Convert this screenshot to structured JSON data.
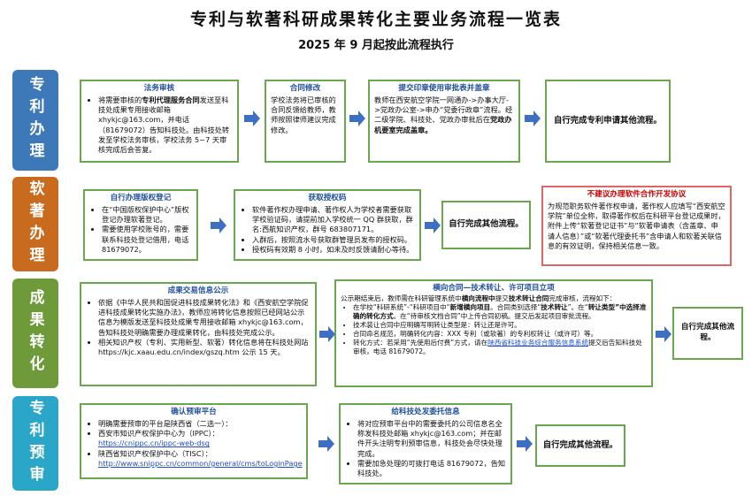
{
  "title": "专利与软著科研成果转化主要业务流程一览表",
  "subtitle": "2025 年 9 月起按此流程执行",
  "colors": {
    "lane_blue": "#3d78b8",
    "lane_orange": "#c96b1e",
    "lane_green": "#6e9a3a",
    "lane_cyan": "#2aa6c9",
    "box_border": "#6aa84f",
    "box_red": "#e06666",
    "arrow": "#3d6fc2",
    "heading": "#1f4e9e"
  },
  "lanes": [
    {
      "label": "专利办理"
    },
    {
      "label": "软著办理"
    },
    {
      "label": "成果转化"
    },
    {
      "label": "专利预审"
    }
  ],
  "patent": {
    "box1": {
      "title": "法务审核",
      "text_a": "将需要审核的",
      "text_b": "专利代理服务合同",
      "text_c": "发送至科技处成果专用接收邮箱 xhykjc@163.com，并电话（81679072）告知科技处。由科技处转发至学校法务审核，学校法务 5~7 天审核完成后会答复。"
    },
    "box2": {
      "title": "合同修改",
      "text": "学校法务将已审核的合同反馈给教师，教师按照律师建议完成修改。"
    },
    "box3": {
      "title": "提交印章使用审批表并盖章",
      "text_a": "教师在西安航空学院一网通办->办事大厅->党政办公室->申办“党委行政章”流程。经二级学院、科技处、党政办审批后在",
      "text_b": "党政办机要室完成盖章。"
    },
    "box4": {
      "text": "自行完成专利申请其他流程。"
    }
  },
  "copyright": {
    "box1": {
      "title": "自行办理版权登记",
      "items": [
        "在“中国版权保护中心”版权登记办理软著登记。",
        "需要使用学校账号的，需要联系科技处登记借用，电话 81679072。"
      ]
    },
    "box2": {
      "title": "获取授权码",
      "items": [
        "软件著作权办理申请、著作权人为学校者需要获取学校验证码，请提前加入学校统一 QQ 群获取，群名:西航知识产权，群号 683807171。",
        "入群后，按照流水号获取群管理员发布的授权码。",
        "授权码有效期 8 小时，如未及时反馈请耐心等待。"
      ]
    },
    "box3": {
      "text": "自行完成其他流程。"
    },
    "box4": {
      "title": "不建议办理软件合作开发协议",
      "text": "为规范职务软件著作权申请，著作权人应填写“西安航空学院”单位全称，取得著作权后在科研平台登记成果时，附件上传“软著登记证书”与“软著申请表（含盖章、申请人信息）”或“软著代理委托书”含申请人和软著关联信息的有效证明，保持相关信息一致。"
    }
  },
  "transfer": {
    "box1": {
      "title": "成果交易信息公示",
      "item1": "依据《中华人民共和国促进科技成果转化法》和《西安航空学院促进科技成果转化实施办法》，教师应将转化信息按照已经网站公示信息为模版发送至科技处成果专用接收邮箱 xhykjc@163.com，告知科技处明确需要办理成果转化，由科技处完成公示。",
      "item2": "相关知识产权（专利、实用新型、软著）转化信息将在科技处网站 https://kjc.xaau.edu.cn/index/gszq.htm 公示 15 天。"
    },
    "box2": {
      "title": "横向合同—技术转让、许可项目立项",
      "intro_a": "公示期结束后，教师需在科研管理系统中",
      "intro_b": "横向流程中",
      "intro_c": "提交",
      "intro_d": "技术转让合同",
      "intro_e": "完成审核，流程如下：",
      "li1_a": "在学校“科研系统”-“科研项目中“",
      "li1_b": "新增横向项目",
      "li1_c": "。合同类别选择“",
      "li1_d": "技术转让",
      "li1_e": "”。在“",
      "li1_f": "转让类型”中选择准确的转化方式",
      "li1_g": "。在“待审核文档合同”中上传合同初稿。提交后发起项目审批流程。",
      "li2": "技术装让合同中应明确写明转让类型是：转让还是许可。",
      "li3": "合同命名规范，明确转化内容：XXX 专利（或软著）的专利权转让（或许可）等。",
      "li4_a": "转化方式：若采用“先使用后付费”方式，请在",
      "li4_link": "陕西省科技业务综合服务信息系统",
      "li4_b": "提交后告知科技处审核，电话 81679072。"
    },
    "box3": {
      "text": "自行完成其他流程。"
    }
  },
  "prereview": {
    "box1": {
      "title": "确认预审平台",
      "item1": "明确需要预审的平台是陕西省（二选一）：",
      "item2": "西安市知识产权保护中心为（IPPC）：",
      "link1": "https://cnippc.cn/ippc-web-dsg",
      "item3": "陕西省知识产权保护中心（TISC）：",
      "link2": "http://www.snippc.cn/common/general/cms/toLoginPage"
    },
    "box2": {
      "title": "给科技处发委托信息",
      "item1": "将对应预审平台中的需要委托的公司信息名全称发科技处邮箱 xhykjc@163.com；并在邮件开头注明专利预审信息，科技处会尽快处理完成。",
      "item2": "需要加急处理的可拨打电话 81679072，告知科技处。"
    },
    "box3": {
      "text": "自行完成其他流程。"
    }
  }
}
